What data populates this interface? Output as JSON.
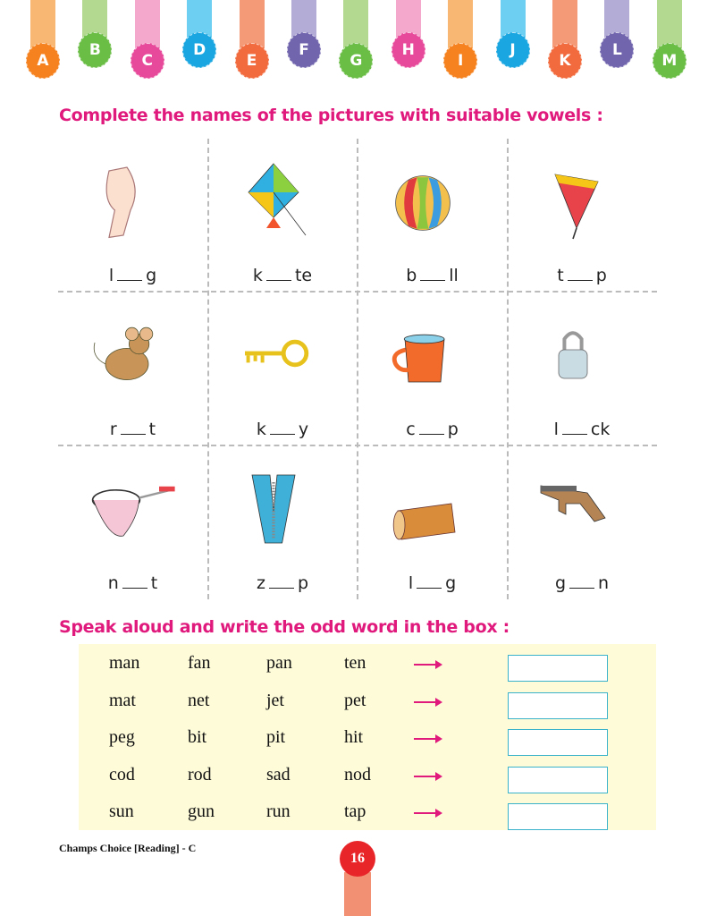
{
  "alphabet": [
    {
      "letter": "A",
      "color": "#f5821f",
      "bar": "#f9b774"
    },
    {
      "letter": "B",
      "color": "#6abd45",
      "bar": "#b3d88f"
    },
    {
      "letter": "C",
      "color": "#e84a9b",
      "bar": "#f4a8cc"
    },
    {
      "letter": "D",
      "color": "#1aa6e0",
      "bar": "#6dcff2"
    },
    {
      "letter": "E",
      "color": "#f26b3e",
      "bar": "#f49a77"
    },
    {
      "letter": "F",
      "color": "#7165ae",
      "bar": "#b2acd6"
    },
    {
      "letter": "G",
      "color": "#6abd45",
      "bar": "#b3d88f"
    },
    {
      "letter": "H",
      "color": "#e84a9b",
      "bar": "#f4a8cc"
    },
    {
      "letter": "I",
      "color": "#f5821f",
      "bar": "#f9b774"
    },
    {
      "letter": "J",
      "color": "#1aa6e0",
      "bar": "#6dcff2"
    },
    {
      "letter": "K",
      "color": "#f26b3e",
      "bar": "#f49a77"
    },
    {
      "letter": "L",
      "color": "#7165ae",
      "bar": "#b2acd6"
    },
    {
      "letter": "M",
      "color": "#6abd45",
      "bar": "#b3d88f"
    }
  ],
  "section1": {
    "title": "Complete the names of the pictures with suitable vowels :",
    "items": [
      {
        "picture": "knee-leg",
        "pre": "l",
        "post": "g"
      },
      {
        "picture": "kite",
        "pre": "k",
        "post": "te"
      },
      {
        "picture": "ball",
        "pre": "b",
        "post": "ll"
      },
      {
        "picture": "top",
        "pre": "t",
        "post": "p"
      },
      {
        "picture": "rat",
        "pre": "r",
        "post": "t"
      },
      {
        "picture": "key",
        "pre": "k",
        "post": "y"
      },
      {
        "picture": "cup",
        "pre": "c",
        "post": "p"
      },
      {
        "picture": "lock",
        "pre": "l",
        "post": "ck"
      },
      {
        "picture": "net",
        "pre": "n",
        "post": "t"
      },
      {
        "picture": "zip",
        "pre": "z",
        "post": "p"
      },
      {
        "picture": "log",
        "pre": "l",
        "post": "g"
      },
      {
        "picture": "gun",
        "pre": "g",
        "post": "n"
      }
    ]
  },
  "section2": {
    "title": "Speak aloud and write the odd word in the box :",
    "rows": [
      {
        "words": [
          "man",
          "fan",
          "pan",
          "ten"
        ],
        "answer": ""
      },
      {
        "words": [
          "mat",
          "net",
          "jet",
          "pet"
        ],
        "answer": ""
      },
      {
        "words": [
          "peg",
          "bit",
          "pit",
          "hit"
        ],
        "answer": ""
      },
      {
        "words": [
          "cod",
          "rod",
          "sad",
          "nod"
        ],
        "answer": ""
      },
      {
        "words": [
          "sun",
          "gun",
          "run",
          "tap"
        ],
        "answer": ""
      }
    ]
  },
  "footer": {
    "book": "Champs Choice [Reading] - C",
    "page": "16"
  }
}
